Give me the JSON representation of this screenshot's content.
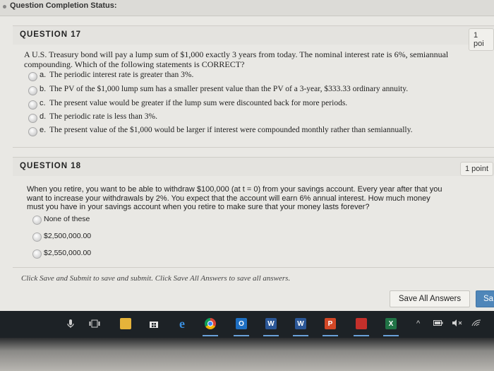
{
  "status": {
    "label": "Question Completion Status:"
  },
  "q17": {
    "title": "QUESTION 17",
    "points": "1 poi",
    "text": "A U.S. Treasury bond will pay a lump sum of $1,000 exactly 3 years from today. The nominal interest rate is 6%, semiannual compounding. Which of the following statements is CORRECT?",
    "options": [
      {
        "letter": "a.",
        "text": "The periodic interest rate is greater than 3%."
      },
      {
        "letter": "b.",
        "text": "The PV of the $1,000 lump sum has a smaller present value than the PV of a 3-year, $333.33 ordinary annuity."
      },
      {
        "letter": "c.",
        "text": "The present value would be greater if the lump sum were discounted back for more periods."
      },
      {
        "letter": "d.",
        "text": "The periodic rate is less than 3%."
      },
      {
        "letter": "e.",
        "text": "The present value of the $1,000 would be larger if interest were compounded monthly rather than semiannually."
      }
    ]
  },
  "q18": {
    "title": "QUESTION 18",
    "points": "1 point",
    "line1": "When you retire, you want to be able to withdraw $100,000 (at t = 0) from your savings account. Every year after that you",
    "line2": "want to increase your withdrawals by 2%. You expect that the account will earn 6% annual interest. How much money",
    "line3": "must you have in your savings account when you retire to make sure that your money lasts forever?",
    "options": [
      "None of these",
      "$2,500,000.00",
      "$2,550,000.00"
    ]
  },
  "footer": {
    "note": "Click Save and Submit to save and submit. Click Save All Answers to save all answers.",
    "save_all": "Save All Answers",
    "save_submit": "Sa"
  },
  "taskbar": {
    "apps": [
      "microphone-icon",
      "task-view-icon",
      "file-explorer-icon",
      "store-icon",
      "edge-icon",
      "chrome-icon",
      "outlook-icon",
      "word-icon",
      "word-icon",
      "powerpoint-icon",
      "acrobat-icon",
      "excel-icon"
    ],
    "labels": {
      "outlook": "O",
      "word": "W",
      "word2": "W",
      "powerpoint": "P",
      "excel": "X"
    }
  }
}
